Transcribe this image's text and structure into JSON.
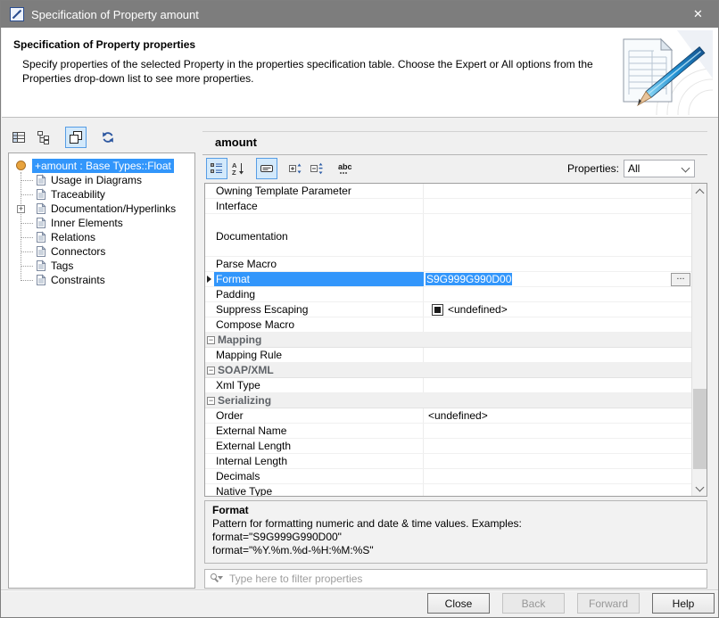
{
  "window": {
    "title": "Specification of Property amount",
    "close_glyph": "✕"
  },
  "header": {
    "title": "Specification of Property properties",
    "description": "Specify properties of the selected Property in the properties specification table. Choose the Expert or All options from the Properties drop-down list to see more properties."
  },
  "glyphs": {
    "expander_plus": "+",
    "group_minus": "−",
    "ellipsis": "...",
    "abc": "abc"
  },
  "left_panel": {
    "toolbar_icons": [
      "properties-view-icon",
      "containment-tree-icon",
      "stack-view-icon",
      "refresh-icon"
    ],
    "tree": {
      "root_label": "+amount : Base Types::Float",
      "items": [
        "Usage in Diagrams",
        "Traceability",
        "Documentation/Hyperlinks",
        "Inner Elements",
        "Relations",
        "Connectors",
        "Tags",
        "Constraints"
      ]
    }
  },
  "right_panel": {
    "title": "amount",
    "toolbar_icons": [
      "categorized-view-icon",
      "alphabetical-sort-icon",
      "show-description-icon",
      "expand-nodes-icon",
      "collapse-nodes-icon",
      "show-abbreviations-icon"
    ],
    "properties_label": "Properties:",
    "properties_value": "All",
    "table": {
      "rows": [
        {
          "label": "Owning Template Parameter",
          "value": ""
        },
        {
          "label": "Interface",
          "value": ""
        },
        {
          "label": "Documentation",
          "value": ""
        },
        {
          "label": "Parse Macro",
          "value": ""
        },
        {
          "label": "Format",
          "value": "S9G999G990D00",
          "editor_button": "..."
        },
        {
          "label": "Padding",
          "value": ""
        },
        {
          "label": "Suppress Escaping",
          "value": "<undefined>"
        },
        {
          "label": "Compose Macro",
          "value": ""
        },
        {
          "label": "Mapping"
        },
        {
          "label": "Mapping Rule",
          "value": ""
        },
        {
          "label": "SOAP/XML"
        },
        {
          "label": "Xml Type",
          "value": ""
        },
        {
          "label": "Serializing"
        },
        {
          "label": "Order",
          "value": "<undefined>"
        },
        {
          "label": "External Name",
          "value": ""
        },
        {
          "label": "External Length",
          "value": ""
        },
        {
          "label": "Internal Length",
          "value": ""
        },
        {
          "label": "Decimals",
          "value": ""
        },
        {
          "label": "Native Type",
          "value": ""
        }
      ]
    },
    "description": {
      "title": "Format",
      "lines": [
        "Pattern for formatting numeric and date & time values. Examples:",
        "format=\"S9G999G990D00\"",
        "format=\"%Y.%m.%d-%H:%M:%S\""
      ]
    },
    "filter": {
      "placeholder": "Type here to filter properties"
    }
  },
  "footer": {
    "close": "Close",
    "back": "Back",
    "forward": "Forward",
    "help": "Help"
  },
  "colors": {
    "selection_blue": "#3296fb",
    "titlebar_gray": "#7d7d7d"
  }
}
